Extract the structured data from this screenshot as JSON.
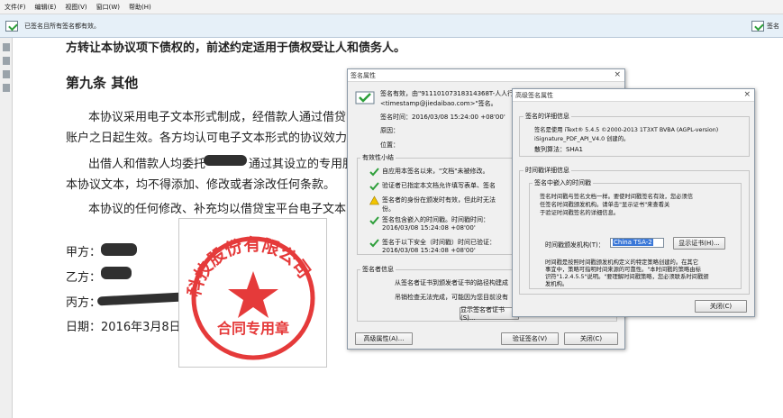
{
  "menu": [
    "文件(F)",
    "编辑(E)",
    "视图(V)",
    "窗口(W)",
    "帮助(H)"
  ],
  "sigbar": {
    "status": "已签名且所有签名都有效。",
    "panel": "签名"
  },
  "doc": {
    "line0": "方转让本协议项下债权的，前述约定适用于债权受让人和债务人。",
    "heading": "第九条 其他",
    "p1a": "本协议采用电子文本形式制成，经借款人通过借贷",
    "p1b": "账户之日起生效。各方均认可电子文本形式的协议效力",
    "p2a": "出借人和借款人均委托",
    "p2b": "通过其设立的专用服",
    "p3": "本协议文本，均不得添加、修改或者涂改任何条款。",
    "p4": "本协议的任何修改、补充均以借贷宝平台电子文本",
    "jia": "甲方：",
    "yi": "乙方：",
    "bing": "丙方：",
    "date": "日期：2016年3月8日"
  },
  "stamp": {
    "top_text": "科技股份有限公司",
    "bottom_text": "合同专用章",
    "color": "#e53a3a"
  },
  "dialog1": {
    "title": "签名属性",
    "valid_line1": "签名有效，由\"91110107318314368T-人人行科技",
    "valid_line2": "<timestamp@jiedaibao.com>\"签名。",
    "sign_time": "签名时间：2016/03/08 15:24:00 +08'00'",
    "reason": "原因：",
    "location": "位置：",
    "summary_title": "有效性小结",
    "s1": "自应用本签名以来，\"文档\"未被修改。",
    "s2": "验证者已指定本文档允许填写表单、签名",
    "s3a": "签名者的身份在颁发时有效，但此时无法",
    "s3b": "份。",
    "s4a": "签名包含嵌入的时间戳。时间戳时间：",
    "s4b": "2016/03/08 15:24:08 +08'00'",
    "s5a": "签名于以下安全（时间戳）时间已验证：",
    "s5b": "2016/03/08 15:24:08 +08'00'",
    "signer_title": "签名者信息",
    "signer1": "从签名者证书到颁发者证书的路径构建成",
    "signer2": "吊销检查无法完成，可能因为您目前没有",
    "show_cert": "显示签名者证书(S)...",
    "advanced": "高级属性(A)...",
    "verify": "验证签名(V)",
    "close": "关闭(C)"
  },
  "dialog2": {
    "title": "高级签名属性",
    "detail_title": "签名的详细信息",
    "created1": "签名是使用 iText® 5.4.5 ©2000-2013 1T3XT BVBA (AGPL-version)",
    "created2": "iSignature_PDF_API_V4.0 创建的。",
    "hash": "散列算法：SHA1",
    "ts_detail_title": "时间戳详细信息",
    "embedded_title": "签名中嵌入的时间戳",
    "emb1": "签名时间戳与签名文档一样。要使时间戳签名有效，您必须信",
    "emb2": "任签名时间戳颁发机构。请单击\"显示证书\"来查看关",
    "emb3": "于验证时间戳签名的详细信息。",
    "authority_label": "时间戳颁发机构(T)：",
    "authority_value": "China TSA-2",
    "show_cert": "显示证书(H)...",
    "policy1": "时间戳是按照时间戳颁发机构定义的特定策略创建的。在其它",
    "policy2": "事宜中，策略可指明时间来源的可靠性。\"本时间戳的策略由标",
    "policy3": "识符\"1.2.4.5.5\"说明。\"要理解时间戳策略，您必须联系时间戳颁",
    "policy4": "发机构。",
    "close": "关闭(C)"
  }
}
